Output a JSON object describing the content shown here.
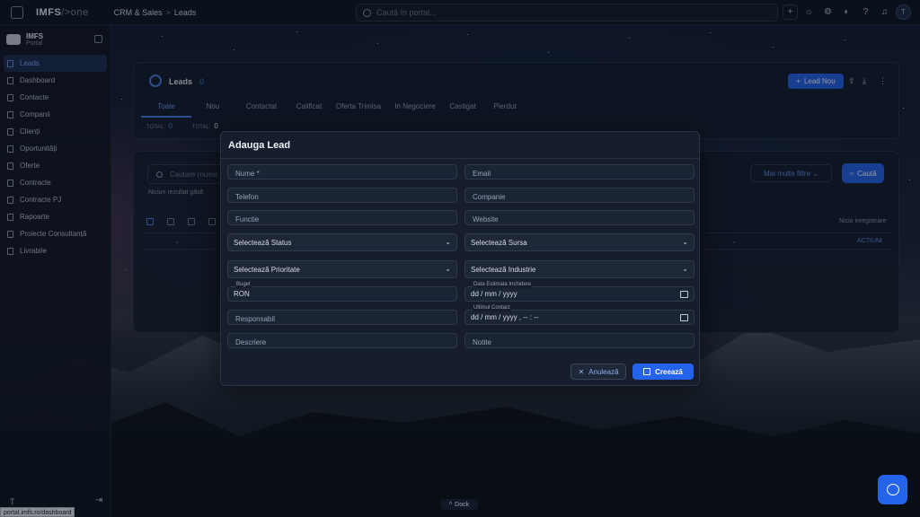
{
  "topbar": {
    "logo": "IMFS",
    "logo_suffix": "/>one",
    "breadcrumb": [
      "CRM & Sales",
      "Leads"
    ],
    "breadcrumb_sep": ">",
    "search_placeholder": "Caută în portal...",
    "avatar_initial": "T"
  },
  "sidebar": {
    "org_name": "IMFS",
    "org_sub": "Portal",
    "items": [
      {
        "label": "Leads",
        "active": true
      },
      {
        "label": "Dashboard"
      },
      {
        "label": "Contacte"
      },
      {
        "label": "Companii"
      },
      {
        "label": "Clienți"
      },
      {
        "label": "Oportunități"
      },
      {
        "label": "Oferte"
      },
      {
        "label": "Contracte"
      },
      {
        "label": "Contracte PJ"
      },
      {
        "label": "Rapoarte"
      },
      {
        "label": "Proiecte Consultanță"
      },
      {
        "label": "Livrabile"
      }
    ],
    "user_initial": "T",
    "url_tooltip": "portal.imfs.ro/dashboard"
  },
  "leads_panel": {
    "title": "Leads",
    "count": "0",
    "new_button": "Lead Nou",
    "tabs": [
      "Toate",
      "Nou",
      "Contactat",
      "Calificat",
      "Oferta Trimisa",
      "In Negociere",
      "Castigat",
      "Pierdut"
    ],
    "totals": [
      {
        "label": "TOTAL:",
        "value": "0"
      },
      {
        "label": "TOTAL:",
        "value": "0"
      }
    ]
  },
  "list_panel": {
    "search_placeholder": "Cautare (nume",
    "no_results": "Niciun rezultat găsit",
    "more_filters": "Mai multe filtre",
    "search_button": "Caută",
    "no_records": "Nicio inregistrare",
    "actions_header": "ACTIUNI"
  },
  "modal": {
    "title": "Adauga Lead",
    "fields": {
      "nume": "Nume *",
      "email": "Email",
      "telefon": "Telefon",
      "companie": "Companie",
      "functie": "Functie",
      "website": "Website",
      "status": "Selectează Status",
      "sursa": "Selectează Sursa",
      "prioritate": "Selectează Prioritate",
      "industrie": "Selectează Industrie",
      "buget_label": "Buget",
      "buget_value": "RON",
      "data_label": "Data Estimata Inchidere",
      "data_value": "dd / mm / yyyy",
      "responsabil": "Responsabil",
      "ultimul_label": "Ultimul Contact",
      "ultimul_value": "dd / mm / yyyy ,  -- : --",
      "descriere": "Descriere",
      "notite": "Notite"
    },
    "cancel": "Anulează",
    "create": "Creează"
  },
  "dock": "Dock",
  "colors": {
    "accent": "#2563eb",
    "accent_text": "#6d9cff"
  }
}
